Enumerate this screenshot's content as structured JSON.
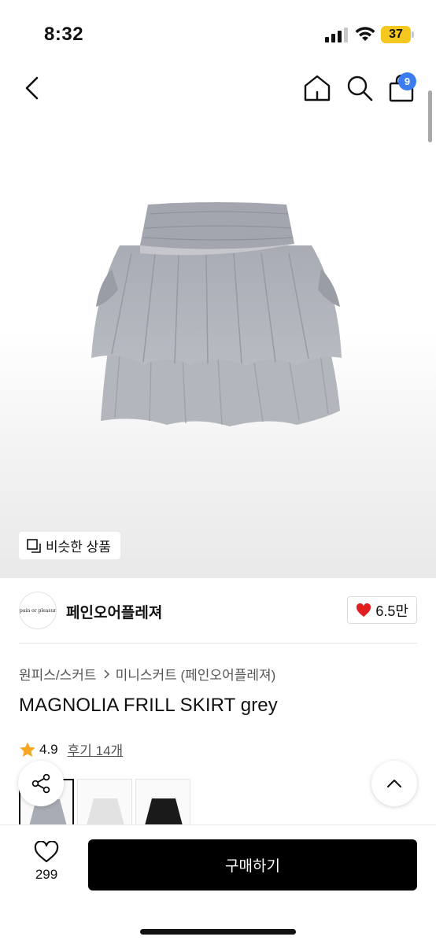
{
  "status_bar": {
    "time": "8:32",
    "battery": "37"
  },
  "nav": {
    "cart_count": "9"
  },
  "hero": {
    "similar_label": "비슷한 상품"
  },
  "seller": {
    "name": "페인오어플레져",
    "logo_text": "pain or pleasure",
    "likes": "6.5만"
  },
  "breadcrumb": {
    "category": "원피스/스커트",
    "subcategory": "미니스커트 (페인오어플레져)"
  },
  "product": {
    "title": "MAGNOLIA FRILL SKIRT grey",
    "rating": "4.9",
    "reviews": "후기 14개"
  },
  "variants": [
    {
      "color": "#a9acb4"
    },
    {
      "color": "#e8e8e8"
    },
    {
      "color": "#1a1a1a"
    }
  ],
  "bottom": {
    "wish_count": "299",
    "buy_label": "구매하기"
  },
  "colors": {
    "accent_badge": "#3b7cf0",
    "heart": "#e02020",
    "star": "#f5a623",
    "buy_button": "#000000"
  }
}
